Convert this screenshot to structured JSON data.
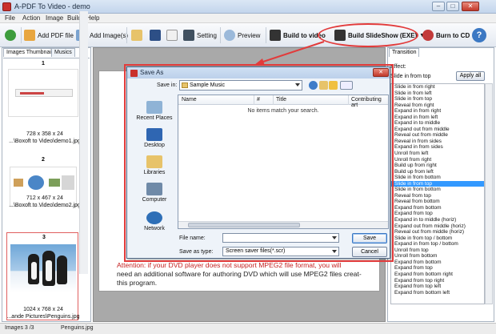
{
  "window": {
    "title": "A-PDF To Video - demo",
    "min_label": "–",
    "max_label": "□",
    "close_label": "✕"
  },
  "menu": [
    "File",
    "Action",
    "Image",
    "Build",
    "Help"
  ],
  "toolbar": {
    "add_pdf": "Add PDF file",
    "add_image": "Add Image(s)",
    "setting": "Setting",
    "preview": "Preview",
    "build_video": "Build to video",
    "build_slideshow": "Build SlideShow (EXE)",
    "burn_cd": "Burn to CD"
  },
  "left_tabs": {
    "thumbnails": "Images Thumbnail",
    "musics": "Musics"
  },
  "thumbnails": [
    {
      "num": "1",
      "size": "728 x 358 x 24",
      "path": "...\\Boxoft to Video\\demo1.jpg"
    },
    {
      "num": "2",
      "size": "712 x 467 x 24",
      "path": "...\\Boxoft to Video\\demo2.jpg"
    },
    {
      "num": "3",
      "size": "1024 x 768 x 24",
      "path": "...ande Pictures\\Penguins.jpg"
    }
  ],
  "document": {
    "line1_red": "Attention: if your DVD player does not support MPEG2 file format, you will",
    "line2": "need an additional software for authoring DVD which will use MPEG2 files creat-",
    "line3": "this program."
  },
  "right_panel": {
    "tab": "Transition",
    "effect_label": "Effect:",
    "selected": "Slide in from top",
    "apply_all": "Apply all",
    "items": [
      "Slide in from right",
      "Slide in from left",
      "Slide in from top",
      "Reveal from right",
      "Expand in from right",
      "Expand in from left",
      "Expand in to middle",
      "Expand out from middle",
      "Reveal out from middle",
      "Reveal in from sides",
      "Expand in from sides",
      "Unroll from left",
      "Unroll from right",
      "Build up from right",
      "Build up from left",
      "Slide in from bottom",
      "Slide in from top",
      "Slide in from bottom",
      "Reveal from top",
      "Reveal from bottom",
      "Expand from bottom",
      "Expand from top",
      "Expand in to middle (horiz)",
      "Expand out from middle (horiz)",
      "Reveal out from middle (horiz)",
      "Slide in from top / bottom",
      "Expand in from top / bottom",
      "Unroll from top",
      "Unroll from bottom",
      "Expand from bottom",
      "Expand from top",
      "Expand from bottom right",
      "Expand from top right",
      "Expand from top left",
      "Expand from bottom left"
    ],
    "selected_index": 16
  },
  "status": {
    "images": "Images 3 /3",
    "file": "Penguins.jpg"
  },
  "dialog": {
    "title": "Save As",
    "save_in_label": "Save in:",
    "save_in_value": "Sample Music",
    "places": [
      "Recent Places",
      "Desktop",
      "Libraries",
      "Computer",
      "Network"
    ],
    "columns": [
      "Name",
      "#",
      "Title",
      "Contributing art"
    ],
    "empty_text": "No items match your search.",
    "file_name_label": "File name:",
    "file_name_value": "",
    "save_type_label": "Save as type:",
    "save_type_value": "Screen saver files(*.scr)",
    "save_button": "Save",
    "cancel_button": "Cancel"
  },
  "colors": {
    "highlight": "#e23b3b",
    "selection": "#3399ff"
  }
}
